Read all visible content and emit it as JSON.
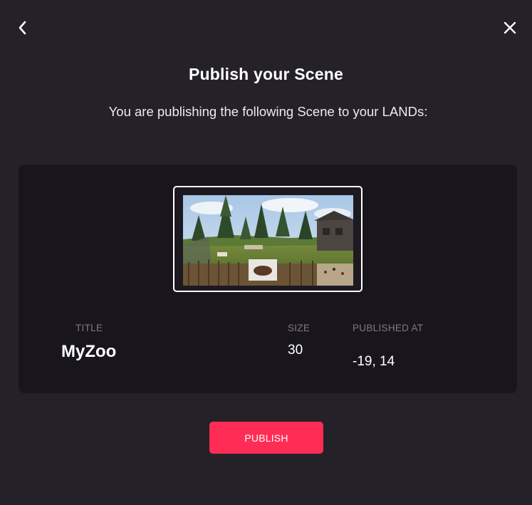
{
  "header": {
    "back_icon": "chevron-left-icon",
    "close_icon": "close-icon",
    "title": "Publish your Scene",
    "subtitle": "You are publishing the following Scene to your LANDs:"
  },
  "scene": {
    "thumbnail_icon": "scene-thumbnail",
    "title_label": "TITLE",
    "title_value": "MyZoo",
    "size_label": "SIZE",
    "size_value": "30",
    "published_label": "PUBLISHED AT",
    "published_value": "-19, 14"
  },
  "actions": {
    "publish_label": "PUBLISH"
  },
  "colors": {
    "background": "#242129",
    "card": "#18161c",
    "accent": "#ff2d55",
    "muted_text": "#7d7a82"
  }
}
